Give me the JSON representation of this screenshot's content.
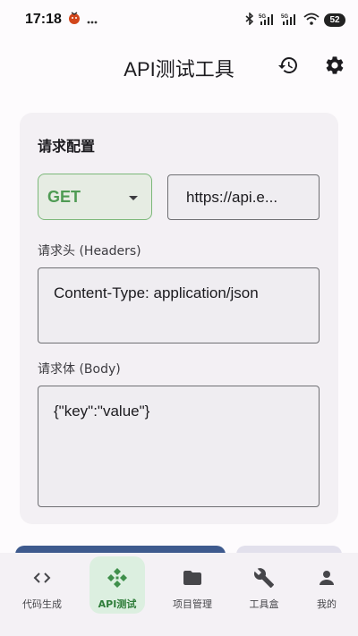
{
  "status_bar": {
    "time": "17:18",
    "battery": "52",
    "notification_icons": [
      "app-notification-icon",
      "more-icon"
    ],
    "system_icons": [
      "bluetooth-icon",
      "signal-5g-icon",
      "signal-5g-icon",
      "wifi-icon",
      "battery-icon"
    ]
  },
  "app_bar": {
    "title": "API测试工具",
    "actions": [
      "history-icon",
      "settings-icon"
    ]
  },
  "request_card": {
    "title": "请求配置",
    "method": {
      "value": "GET",
      "icon": "dropdown-arrow-icon"
    },
    "url": {
      "value": "https://api.e..."
    },
    "headers": {
      "label": "请求头 (Headers)",
      "value": "Content-Type: application/json"
    },
    "body": {
      "label": "请求体 (Body)",
      "value": "{\"key\":\"value\"}"
    }
  },
  "bottom_nav": {
    "active_index": 1,
    "items": [
      {
        "label": "代码生成",
        "icon": "code-icon"
      },
      {
        "label": "API测试",
        "icon": "api-icon"
      },
      {
        "label": "项目管理",
        "icon": "folder-icon"
      },
      {
        "label": "工具盒",
        "icon": "wrench-icon"
      },
      {
        "label": "我的",
        "icon": "person-icon"
      }
    ]
  },
  "colors": {
    "accent": "#4f9b54",
    "active_nav_bg": "#dcefe0",
    "primary_button": "#3e5a8e"
  }
}
